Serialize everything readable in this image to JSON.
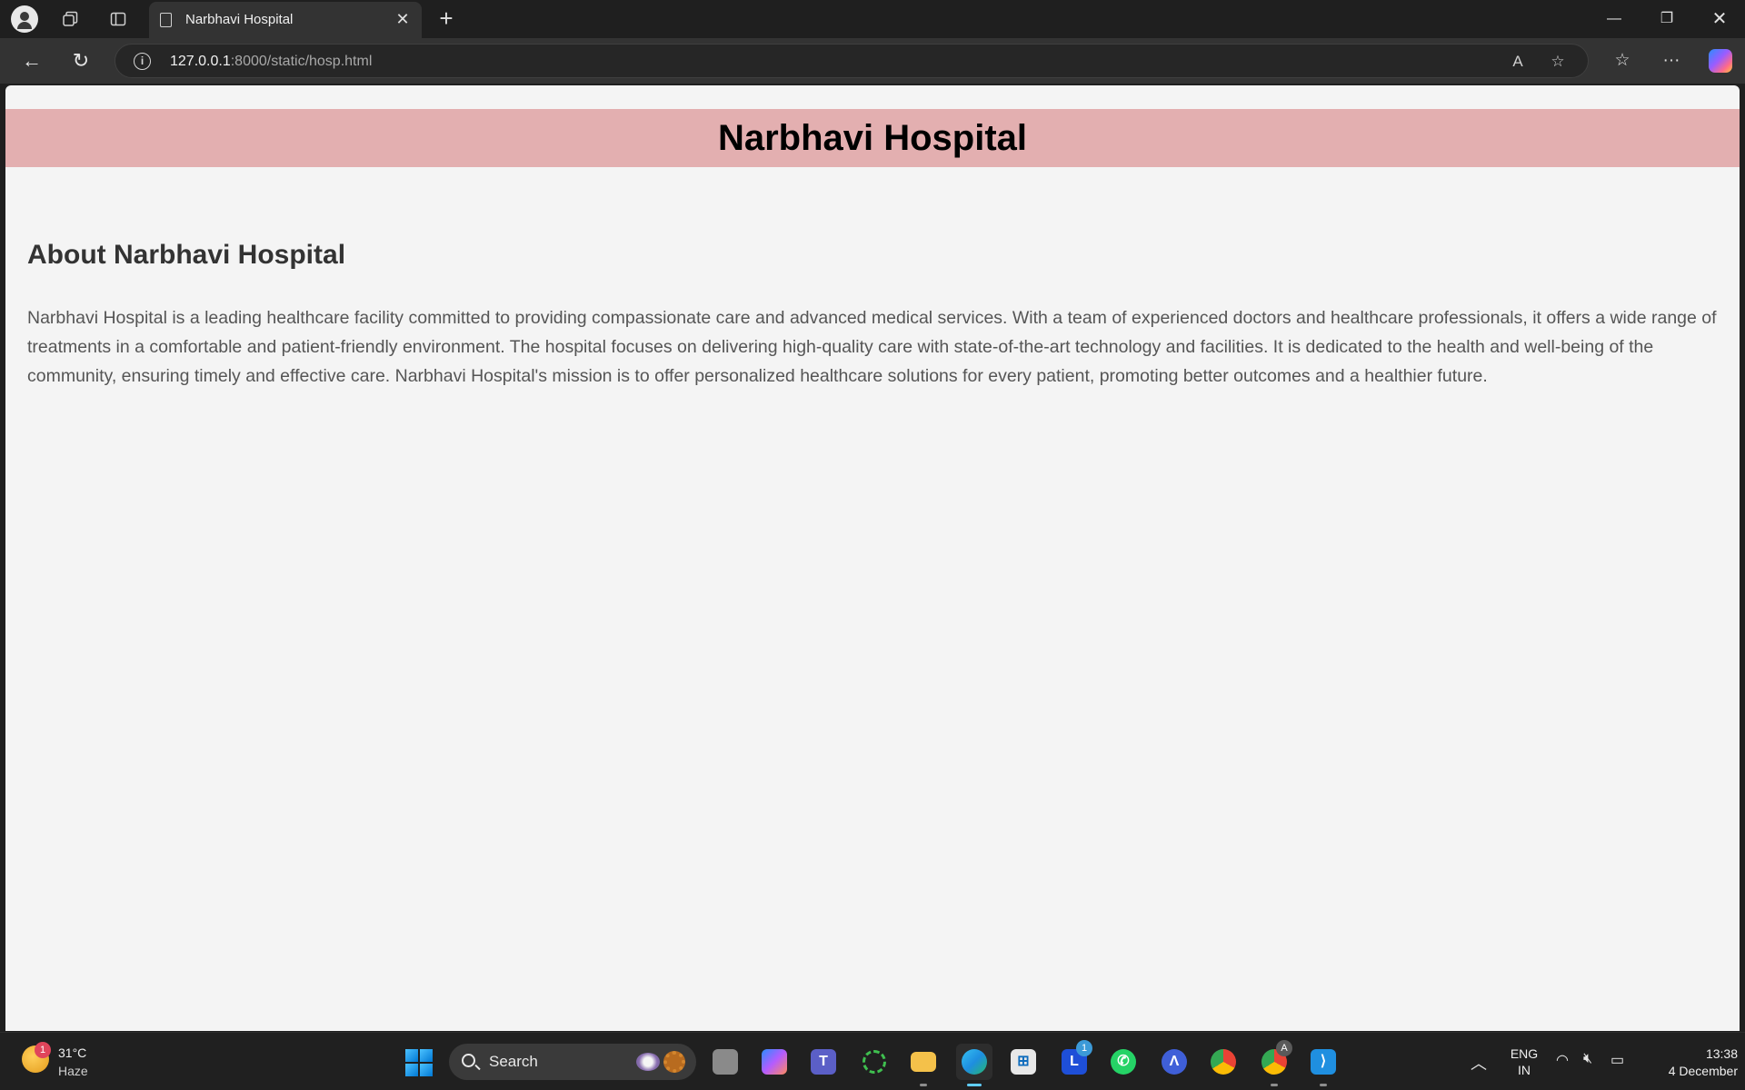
{
  "browser": {
    "tab_title": "Narbhavi Hospital",
    "url_host": "127.0.0.1",
    "url_rest": ":8000/static/hosp.html"
  },
  "page": {
    "banner_title": "Narbhavi Hospital",
    "about_heading": "About Narbhavi Hospital",
    "about_text": "Narbhavi Hospital is a leading healthcare facility committed to providing compassionate care and advanced medical services. With a team of experienced doctors and healthcare professionals, it offers a wide range of treatments in a comfortable and patient-friendly environment. The hospital focuses on delivering high-quality care with state-of-the-art technology and facilities. It is dedicated to the health and well-being of the community, ensuring timely and effective care. Narbhavi Hospital's mission is to offer personalized healthcare solutions for every patient, promoting better outcomes and a healthier future."
  },
  "taskbar": {
    "weather_temp": "31°C",
    "weather_condition": "Haze",
    "weather_badge": "1",
    "search_label": "Search",
    "teams_badge": "1",
    "chrome_profile_badge": "A",
    "lang_primary": "ENG",
    "lang_secondary": "IN",
    "time": "13:38",
    "date": "4 December"
  },
  "colors": {
    "banner": "#e3afb0",
    "page_background": "#f4f4f4",
    "chrome_dark": "#1f1f1f",
    "toolbar": "#333333"
  }
}
